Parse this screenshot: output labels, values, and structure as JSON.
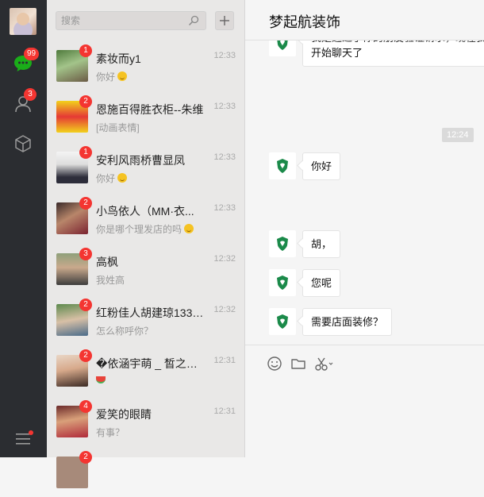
{
  "rail": {
    "chat_badge": "99",
    "contacts_badge": "3"
  },
  "search": {
    "placeholder": "搜索"
  },
  "conversations": [
    {
      "name": "素妆而y1",
      "time": "12:33",
      "preview": "你好",
      "unread": "1",
      "emoji": "smile"
    },
    {
      "name": "恩施百得胜衣柜--朱维",
      "time": "12:33",
      "preview": "[动画表情]",
      "unread": "2",
      "emoji": ""
    },
    {
      "name": "安利风雨桥曹显凤",
      "time": "12:33",
      "preview": "你好",
      "unread": "1",
      "emoji": "smile"
    },
    {
      "name": "小鸟依人（MM·衣...",
      "time": "12:33",
      "preview": "你是哪个理发店的吗",
      "unread": "2",
      "emoji": "smile"
    },
    {
      "name": "高枫",
      "time": "12:32",
      "preview": "我姓高",
      "unread": "3",
      "emoji": ""
    },
    {
      "name": "红粉佳人胡建琼1334...",
      "time": "12:32",
      "preview": "怎么称呼你？",
      "unread": "2",
      "emoji": ""
    },
    {
      "name": "�依涵宇萌 _ 皙之密�",
      "time": "12:31",
      "preview": "",
      "unread": "2",
      "emoji": "melon"
    },
    {
      "name": "爱笑的眼睛",
      "time": "12:31",
      "preview": "有事？",
      "unread": "4",
      "emoji": ""
    }
  ],
  "conversation_last_unread": "2",
  "chat": {
    "title": "梦起航装饰",
    "first_bubble": "开始聊天了",
    "timestamp": "12:24",
    "messages": [
      "你好",
      "胡，",
      "您呢",
      "需要店面装修？"
    ]
  },
  "icons": {
    "chat": "chat-bubble-icon",
    "contacts": "contacts-icon",
    "favorites": "cube-icon",
    "menu": "menu-icon",
    "search": "search-icon",
    "add": "plus-icon",
    "emoji": "emoji-icon",
    "folder": "folder-icon",
    "scissors": "scissors-icon"
  },
  "colors": {
    "rail_bg": "#2b2d31",
    "badge": "#f43531",
    "chat_green": "#1aad19",
    "bot_logo": "#1b8a4a"
  }
}
